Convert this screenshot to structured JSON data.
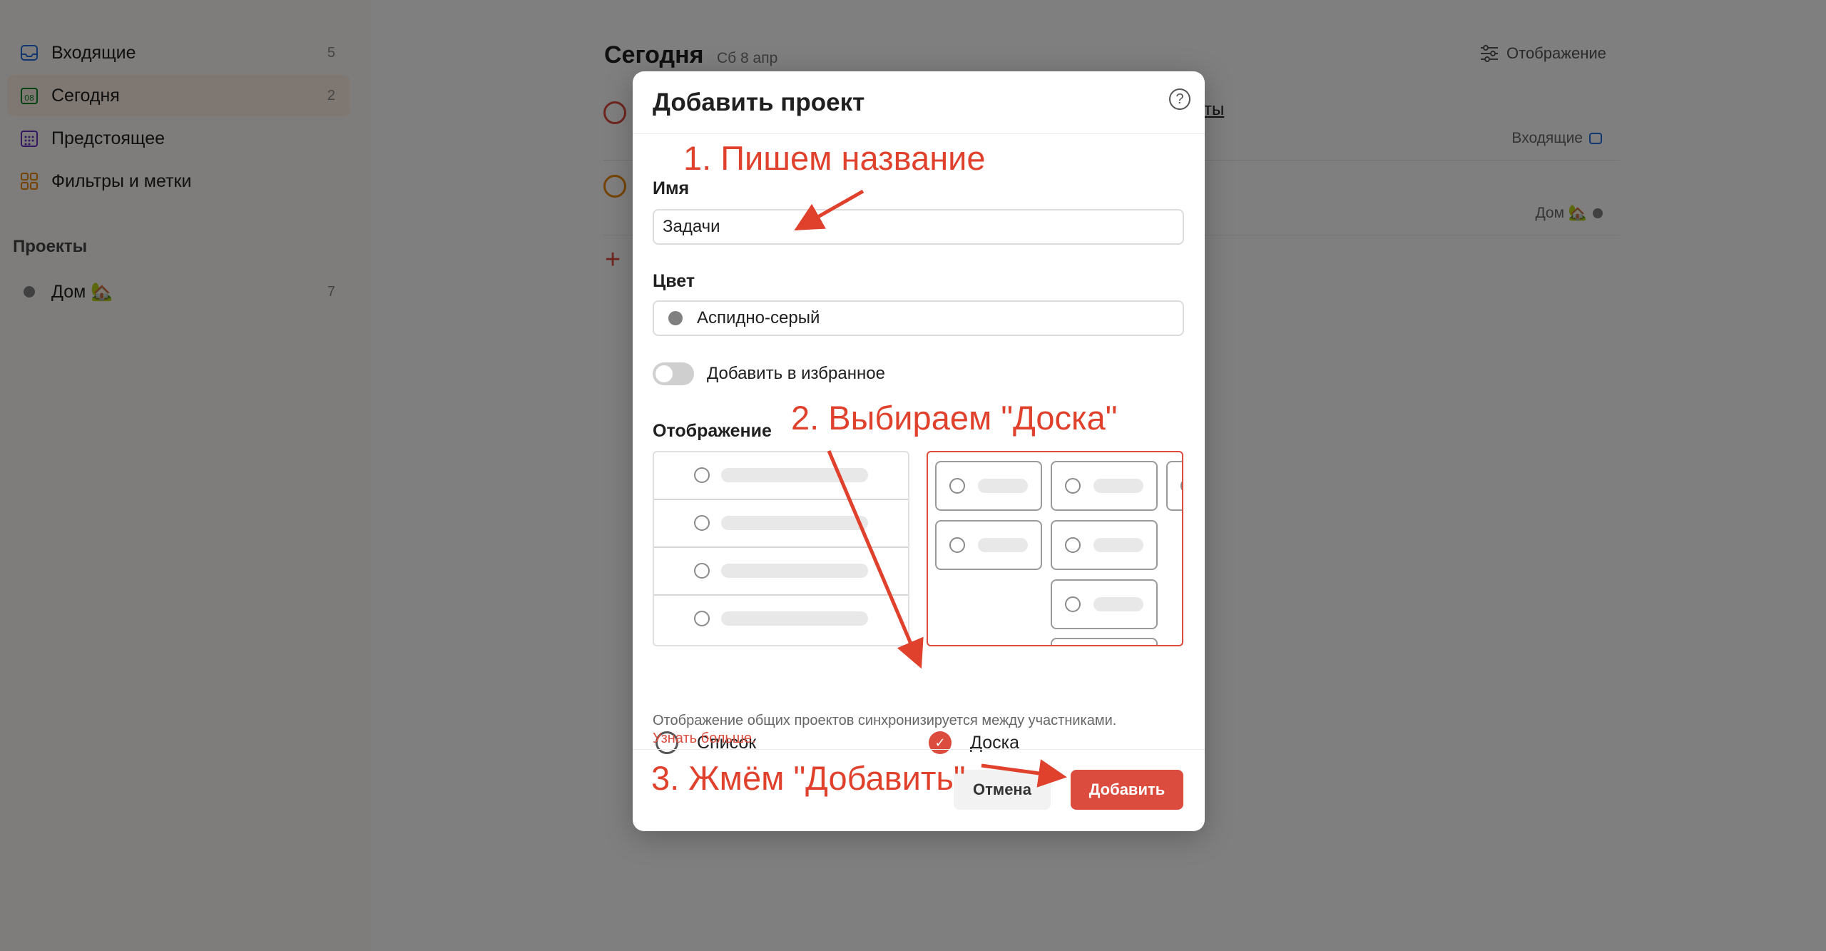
{
  "sidebar": {
    "items": [
      {
        "label": "Входящие",
        "count": "5",
        "icon": "inbox-icon"
      },
      {
        "label": "Сегодня",
        "count": "2",
        "icon": "calendar-today-icon",
        "icon_text": "08"
      },
      {
        "label": "Предстоящее",
        "count": "",
        "icon": "calendar-grid-icon"
      },
      {
        "label": "Фильтры и метки",
        "count": "",
        "icon": "filters-icon"
      }
    ],
    "projects_title": "Проекты",
    "projects": [
      {
        "label": "Дом 🏡",
        "count": "7",
        "color": "#808080"
      }
    ]
  },
  "main": {
    "title": "Сегодня",
    "date": "Сб 8 апр",
    "view_button": "Отображение",
    "tasks": [
      {
        "text_fragment": "ты",
        "project": "Входящие",
        "circle_color": "#dc4c3e"
      },
      {
        "text_fragment": "",
        "project": "Дом 🏡",
        "circle_color": "#eb8909"
      }
    ]
  },
  "modal": {
    "title": "Добавить проект",
    "help": "?",
    "name_label": "Имя",
    "name_value": "Задачи",
    "color_label": "Цвет",
    "color_value": "Аспидно-серый",
    "color_hex": "#808080",
    "favorite_label": "Добавить в избранное",
    "favorite_on": false,
    "view_label": "Отображение",
    "view_options": [
      {
        "label": "Список",
        "selected": false
      },
      {
        "label": "Доска",
        "selected": true
      }
    ],
    "footnote_text": "Отображение общих проектов синхронизируется между участниками.",
    "footnote_link": "Узнать больше.",
    "cancel_label": "Отмена",
    "add_label": "Добавить"
  },
  "annotations": {
    "step1": "1. Пишем название",
    "step2": "2. Выбираем \"Доска\"",
    "step3": "3. Жмём \"Добавить\"",
    "color": "#e0412c"
  }
}
